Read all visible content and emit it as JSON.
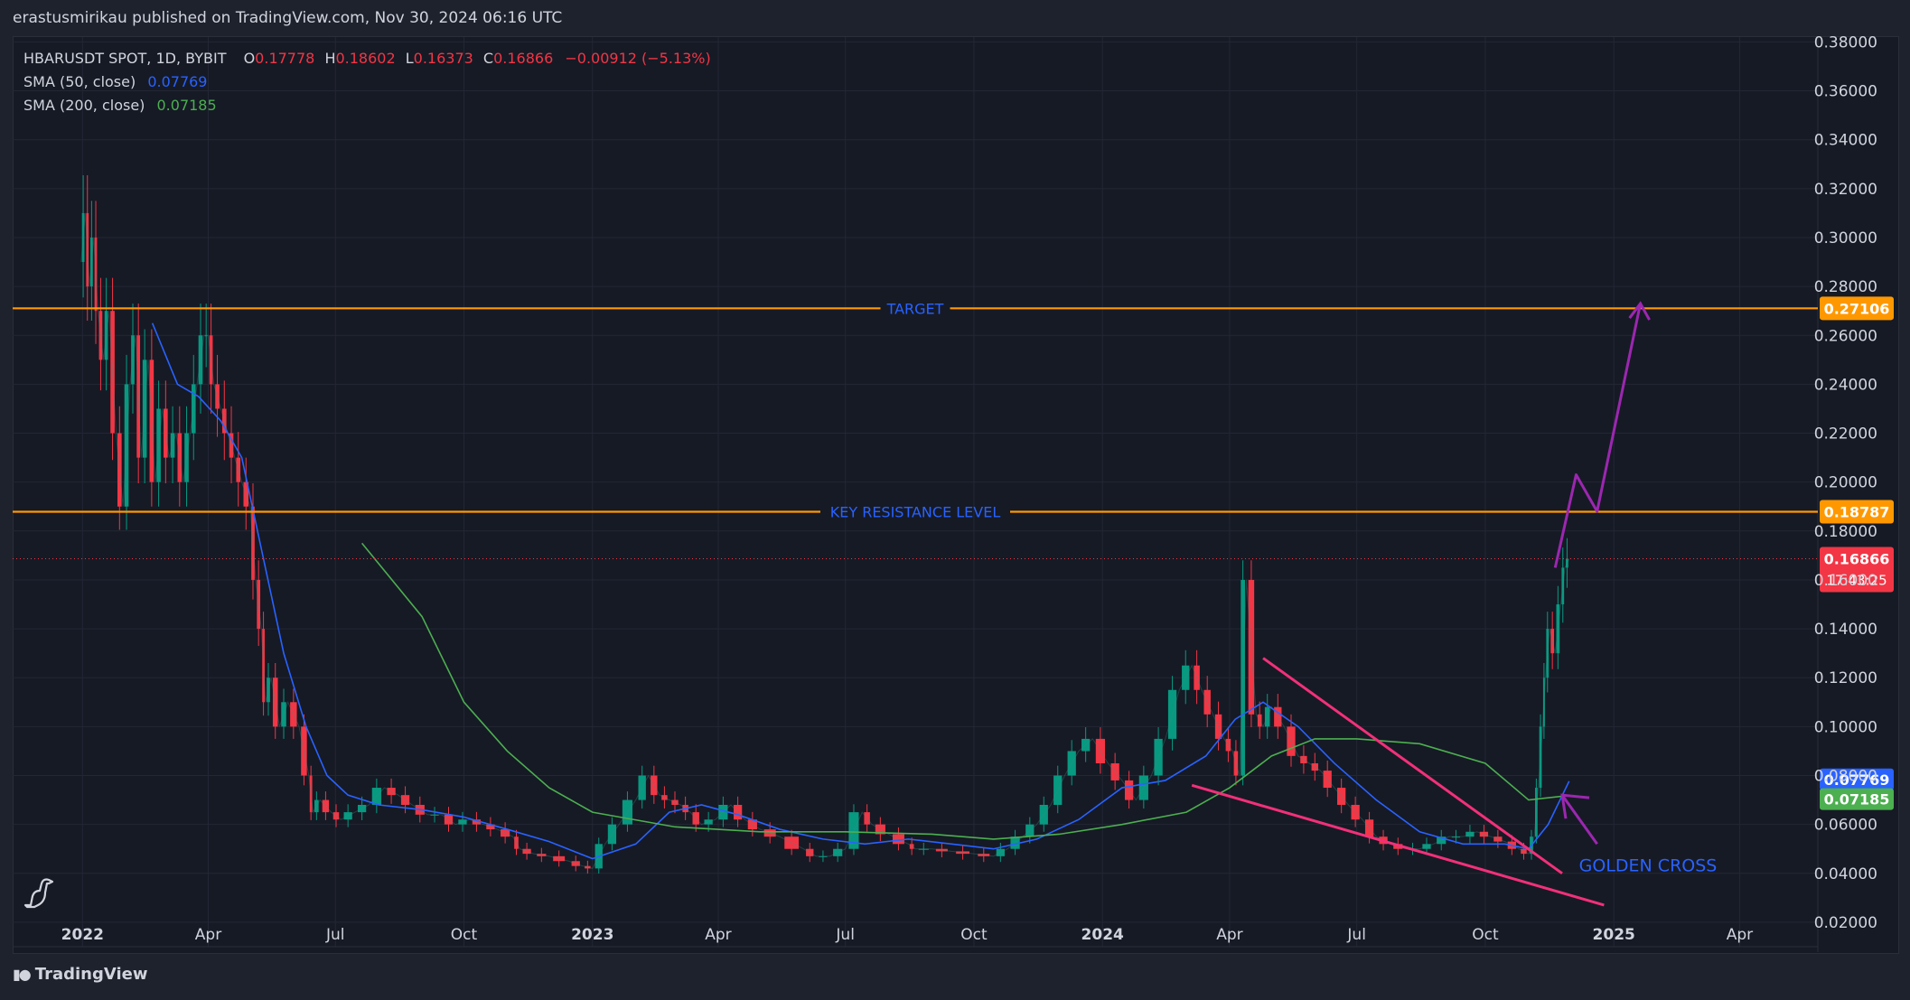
{
  "header": {
    "published_by": "erastusmirikau published on TradingView.com, Nov 30, 2024 06:16 UTC"
  },
  "legend": {
    "symbol": "HBARUSDT SPOT, 1D, BYBIT",
    "open_key": "O",
    "open": "0.17778",
    "high_key": "H",
    "high": "0.18602",
    "low_key": "L",
    "low": "0.16373",
    "close_key": "C",
    "close": "0.16866",
    "change": "−0.00912 (−5.13%)",
    "sma50_label": "SMA (50, close)",
    "sma50_value": "0.07769",
    "sma200_label": "SMA (200, close)",
    "sma200_value": "0.07185"
  },
  "footer": {
    "brand": "TradingView"
  },
  "colors": {
    "background": "#161a25",
    "up": "#089981",
    "down": "#f23645",
    "sma50": "#2962ff",
    "sma200": "#4caf50",
    "level": "#ff9800",
    "wedge": "#f23079",
    "projection": "#9c27b0",
    "annotation_text": "#2962ff"
  },
  "chart_data": {
    "type": "line",
    "title": "HBARUSDT SPOT, 1D, BYBIT",
    "x_axis": {
      "type": "time",
      "tick_labels": [
        "2022",
        "Apr",
        "Jul",
        "Oct",
        "2023",
        "Apr",
        "Jul",
        "Oct",
        "2024",
        "Apr",
        "Jul",
        "Oct",
        "2025",
        "Apr"
      ],
      "tick_dates": [
        "2022-01-01",
        "2022-04-01",
        "2022-07-01",
        "2022-10-01",
        "2023-01-01",
        "2023-04-01",
        "2023-07-01",
        "2023-10-01",
        "2024-01-01",
        "2024-04-01",
        "2024-07-01",
        "2024-10-01",
        "2025-01-01",
        "2025-04-01"
      ],
      "range": [
        "2021-11-12",
        "2025-05-27"
      ]
    },
    "y_axis": {
      "range": [
        0.01,
        0.382
      ],
      "tick_labels": [
        "0.02000",
        "0.04000",
        "0.06000",
        "0.08000",
        "0.10000",
        "0.12000",
        "0.14000",
        "0.16000",
        "0.18000",
        "0.20000",
        "0.22000",
        "0.24000",
        "0.26000",
        "0.28000",
        "0.30000",
        "0.32000",
        "0.34000",
        "0.36000",
        "0.38000"
      ],
      "tick_values": [
        0.02,
        0.04,
        0.06,
        0.08,
        0.1,
        0.12,
        0.14,
        0.16,
        0.18,
        0.2,
        0.22,
        0.24,
        0.26,
        0.28,
        0.3,
        0.32,
        0.34,
        0.36,
        0.38
      ],
      "position": "right"
    },
    "price_series": {
      "name": "HBARUSDT",
      "dates": [
        "2021-12-31",
        "2022-01-03",
        "2022-01-06",
        "2022-01-09",
        "2022-01-12",
        "2022-01-16",
        "2022-01-20",
        "2022-01-25",
        "2022-01-30",
        "2022-02-04",
        "2022-02-08",
        "2022-02-12",
        "2022-02-17",
        "2022-02-22",
        "2022-02-27",
        "2022-03-04",
        "2022-03-09",
        "2022-03-14",
        "2022-03-19",
        "2022-03-24",
        "2022-03-29",
        "2022-04-01",
        "2022-04-05",
        "2022-04-10",
        "2022-04-15",
        "2022-04-20",
        "2022-04-25",
        "2022-05-01",
        "2022-05-05",
        "2022-05-09",
        "2022-05-12",
        "2022-05-16",
        "2022-05-22",
        "2022-05-28",
        "2022-06-05",
        "2022-06-12",
        "2022-06-15",
        "2022-06-20",
        "2022-06-28",
        "2022-07-05",
        "2022-07-15",
        "2022-07-25",
        "2022-08-05",
        "2022-08-15",
        "2022-08-25",
        "2022-09-05",
        "2022-09-15",
        "2022-09-25",
        "2022-10-05",
        "2022-10-15",
        "2022-10-25",
        "2022-11-05",
        "2022-11-10",
        "2022-11-20",
        "2022-12-01",
        "2022-12-15",
        "2022-12-25",
        "2023-01-01",
        "2023-01-10",
        "2023-01-20",
        "2023-02-01",
        "2023-02-10",
        "2023-02-18",
        "2023-02-25",
        "2023-03-05",
        "2023-03-12",
        "2023-03-20",
        "2023-03-30",
        "2023-04-10",
        "2023-04-20",
        "2023-05-01",
        "2023-05-15",
        "2023-06-01",
        "2023-06-10",
        "2023-06-20",
        "2023-07-01",
        "2023-07-13",
        "2023-07-20",
        "2023-08-01",
        "2023-08-15",
        "2023-08-20",
        "2023-09-01",
        "2023-09-15",
        "2023-10-01",
        "2023-10-15",
        "2023-10-25",
        "2023-11-05",
        "2023-11-15",
        "2023-11-25",
        "2023-12-05",
        "2023-12-15",
        "2023-12-25",
        "2024-01-05",
        "2024-01-15",
        "2024-01-25",
        "2024-02-05",
        "2024-02-15",
        "2024-02-25",
        "2024-03-05",
        "2024-03-12",
        "2024-03-20",
        "2024-03-28",
        "2024-04-03",
        "2024-04-08",
        "2024-04-13",
        "2024-04-20",
        "2024-04-25",
        "2024-05-01",
        "2024-05-10",
        "2024-05-20",
        "2024-05-28",
        "2024-06-05",
        "2024-06-15",
        "2024-06-25",
        "2024-07-05",
        "2024-07-15",
        "2024-07-25",
        "2024-08-05",
        "2024-08-15",
        "2024-08-25",
        "2024-09-05",
        "2024-09-15",
        "2024-09-25",
        "2024-10-05",
        "2024-10-15",
        "2024-10-25",
        "2024-11-01",
        "2024-11-05",
        "2024-11-08",
        "2024-11-11",
        "2024-11-13",
        "2024-11-16",
        "2024-11-20",
        "2024-11-24",
        "2024-11-27",
        "2024-11-30"
      ],
      "close": [
        0.29,
        0.31,
        0.28,
        0.3,
        0.27,
        0.25,
        0.27,
        0.22,
        0.19,
        0.24,
        0.26,
        0.21,
        0.25,
        0.2,
        0.23,
        0.21,
        0.22,
        0.2,
        0.22,
        0.24,
        0.26,
        0.26,
        0.24,
        0.23,
        0.22,
        0.21,
        0.2,
        0.19,
        0.16,
        0.14,
        0.11,
        0.12,
        0.1,
        0.11,
        0.1,
        0.08,
        0.065,
        0.07,
        0.065,
        0.062,
        0.065,
        0.068,
        0.075,
        0.072,
        0.068,
        0.064,
        0.064,
        0.06,
        0.062,
        0.06,
        0.058,
        0.055,
        0.05,
        0.048,
        0.047,
        0.045,
        0.043,
        0.042,
        0.052,
        0.06,
        0.07,
        0.08,
        0.072,
        0.07,
        0.068,
        0.065,
        0.06,
        0.062,
        0.068,
        0.062,
        0.058,
        0.055,
        0.05,
        0.047,
        0.047,
        0.05,
        0.065,
        0.06,
        0.056,
        0.052,
        0.05,
        0.05,
        0.049,
        0.048,
        0.047,
        0.05,
        0.055,
        0.06,
        0.068,
        0.08,
        0.09,
        0.095,
        0.085,
        0.078,
        0.07,
        0.08,
        0.095,
        0.115,
        0.125,
        0.115,
        0.105,
        0.095,
        0.09,
        0.08,
        0.16,
        0.105,
        0.1,
        0.108,
        0.1,
        0.088,
        0.085,
        0.082,
        0.075,
        0.068,
        0.062,
        0.055,
        0.052,
        0.05,
        0.05,
        0.052,
        0.055,
        0.055,
        0.057,
        0.055,
        0.053,
        0.05,
        0.048,
        0.055,
        0.075,
        0.1,
        0.12,
        0.14,
        0.13,
        0.15,
        0.165,
        0.16866
      ]
    },
    "series": [
      {
        "name": "SMA (50, close)",
        "dates": [
          "2022-02-20",
          "2022-03-10",
          "2022-03-25",
          "2022-04-10",
          "2022-04-25",
          "2022-05-10",
          "2022-05-25",
          "2022-06-10",
          "2022-06-25",
          "2022-07-10",
          "2022-08-01",
          "2022-09-01",
          "2022-10-01",
          "2022-11-01",
          "2022-12-01",
          "2023-01-01",
          "2023-02-01",
          "2023-02-25",
          "2023-03-20",
          "2023-04-15",
          "2023-05-15",
          "2023-06-15",
          "2023-07-15",
          "2023-08-15",
          "2023-09-15",
          "2023-10-15",
          "2023-11-15",
          "2023-12-15",
          "2024-01-15",
          "2024-02-15",
          "2024-03-15",
          "2024-04-05",
          "2024-04-25",
          "2024-05-20",
          "2024-06-15",
          "2024-07-15",
          "2024-08-15",
          "2024-09-15",
          "2024-10-15",
          "2024-11-01",
          "2024-11-15",
          "2024-11-30"
        ],
        "values": [
          0.265,
          0.24,
          0.235,
          0.225,
          0.21,
          0.17,
          0.13,
          0.1,
          0.08,
          0.072,
          0.068,
          0.066,
          0.063,
          0.058,
          0.053,
          0.046,
          0.052,
          0.065,
          0.068,
          0.064,
          0.058,
          0.054,
          0.052,
          0.054,
          0.052,
          0.05,
          0.054,
          0.062,
          0.075,
          0.078,
          0.088,
          0.103,
          0.11,
          0.1,
          0.085,
          0.07,
          0.057,
          0.052,
          0.052,
          0.05,
          0.06,
          0.07769
        ]
      },
      {
        "name": "SMA (200, close)",
        "dates": [
          "2022-07-20",
          "2022-09-01",
          "2022-10-01",
          "2022-11-01",
          "2022-12-01",
          "2023-01-01",
          "2023-03-01",
          "2023-05-01",
          "2023-07-01",
          "2023-09-01",
          "2023-10-15",
          "2023-12-01",
          "2024-01-15",
          "2024-03-01",
          "2024-04-01",
          "2024-05-01",
          "2024-06-01",
          "2024-07-01",
          "2024-08-15",
          "2024-10-01",
          "2024-11-01",
          "2024-11-30"
        ],
        "values": [
          0.175,
          0.145,
          0.11,
          0.09,
          0.075,
          0.065,
          0.059,
          0.057,
          0.057,
          0.056,
          0.054,
          0.056,
          0.06,
          0.065,
          0.075,
          0.088,
          0.095,
          0.095,
          0.093,
          0.085,
          0.07,
          0.07185
        ]
      }
    ],
    "horizontal_levels": [
      {
        "label": "TARGET",
        "value": 0.27106,
        "axis_label": "0.27106"
      },
      {
        "label": "KEY RESISTANCE LEVEL",
        "value": 0.18787,
        "axis_label": "0.18787"
      }
    ],
    "current_price": {
      "value": 0.16866,
      "axis_label": "0.16866",
      "countdown": "17:43:25"
    },
    "axis_markers": [
      {
        "value": 0.07769,
        "axis_label": "0.07769",
        "series": "SMA (50, close)"
      },
      {
        "value": 0.07185,
        "axis_label": "0.07185",
        "series": "SMA (200, close)"
      }
    ],
    "wedge_lines": [
      {
        "from": [
          "2024-04-25",
          0.128
        ],
        "to": [
          "2024-11-25",
          0.04
        ]
      },
      {
        "from": [
          "2024-03-05",
          0.076
        ],
        "to": [
          "2024-12-25",
          0.027
        ]
      }
    ],
    "projection_path": {
      "dates": [
        "2024-11-20",
        "2024-12-05",
        "2024-12-20",
        "2025-01-20"
      ],
      "values": [
        0.165,
        0.203,
        0.188,
        0.273
      ]
    },
    "golden_cross": {
      "label": "GOLDEN CROSS",
      "arrow_from": [
        "2024-12-20",
        0.052
      ],
      "arrow_to": [
        "2024-11-25",
        0.072
      ]
    },
    "grid": true,
    "legend_placement": "top-left"
  }
}
